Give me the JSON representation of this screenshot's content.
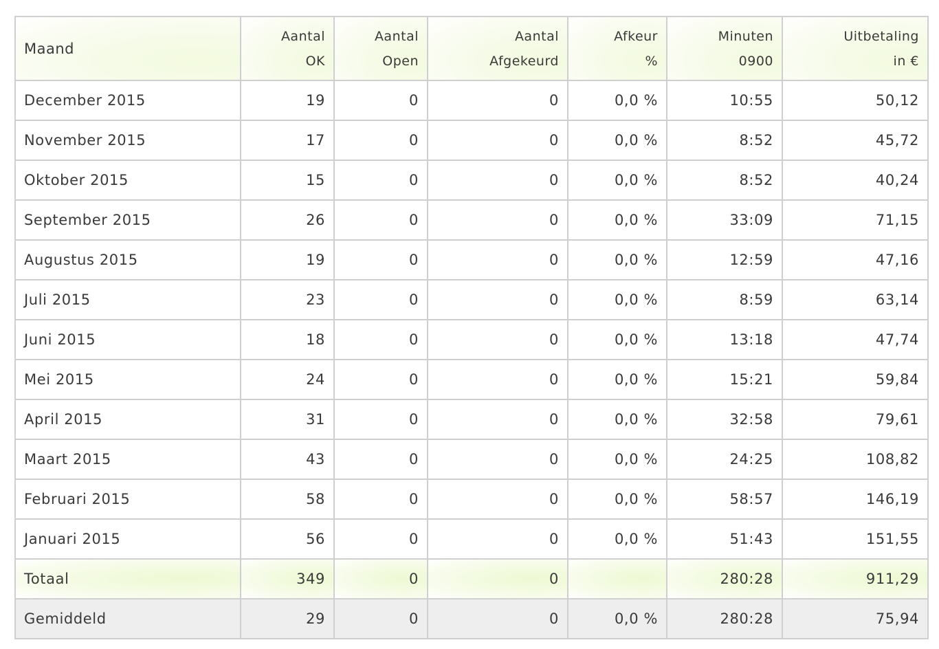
{
  "columns": [
    {
      "line1": "Maand",
      "line2": ""
    },
    {
      "line1": "Aantal",
      "line2": "OK"
    },
    {
      "line1": "Aantal",
      "line2": "Open"
    },
    {
      "line1": "Aantal",
      "line2": "Afgekeurd"
    },
    {
      "line1": "Afkeur",
      "line2": "%"
    },
    {
      "line1": "Minuten",
      "line2": "0900"
    },
    {
      "line1": "Uitbetaling",
      "line2": "in €"
    }
  ],
  "rows": [
    [
      "December 2015",
      "19",
      "0",
      "0",
      "0,0 %",
      "10:55",
      "50,12"
    ],
    [
      "November 2015",
      "17",
      "0",
      "0",
      "0,0 %",
      "8:52",
      "45,72"
    ],
    [
      "Oktober 2015",
      "15",
      "0",
      "0",
      "0,0 %",
      "8:52",
      "40,24"
    ],
    [
      "September 2015",
      "26",
      "0",
      "0",
      "0,0 %",
      "33:09",
      "71,15"
    ],
    [
      "Augustus 2015",
      "19",
      "0",
      "0",
      "0,0 %",
      "12:59",
      "47,16"
    ],
    [
      "Juli 2015",
      "23",
      "0",
      "0",
      "0,0 %",
      "8:59",
      "63,14"
    ],
    [
      "Juni 2015",
      "18",
      "0",
      "0",
      "0,0 %",
      "13:18",
      "47,74"
    ],
    [
      "Mei 2015",
      "24",
      "0",
      "0",
      "0,0 %",
      "15:21",
      "59,84"
    ],
    [
      "April 2015",
      "31",
      "0",
      "0",
      "0,0 %",
      "32:58",
      "79,61"
    ],
    [
      "Maart 2015",
      "43",
      "0",
      "0",
      "0,0 %",
      "24:25",
      "108,82"
    ],
    [
      "Februari 2015",
      "58",
      "0",
      "0",
      "0,0 %",
      "58:57",
      "146,19"
    ],
    [
      "Januari 2015",
      "56",
      "0",
      "0",
      "0,0 %",
      "51:43",
      "151,55"
    ]
  ],
  "total": [
    "Totaal",
    "349",
    "0",
    "0",
    "",
    "280:28",
    "911,29"
  ],
  "average": [
    "Gemiddeld",
    "29",
    "0",
    "0",
    "0,0 %",
    "280:28",
    "75,94"
  ],
  "colors": {
    "border": "#cfcfcf",
    "header_tint": "#f3fbdf",
    "total_tint": "#eef9d3",
    "average_bg": "#eeeeee",
    "text": "#3a3a3a"
  }
}
